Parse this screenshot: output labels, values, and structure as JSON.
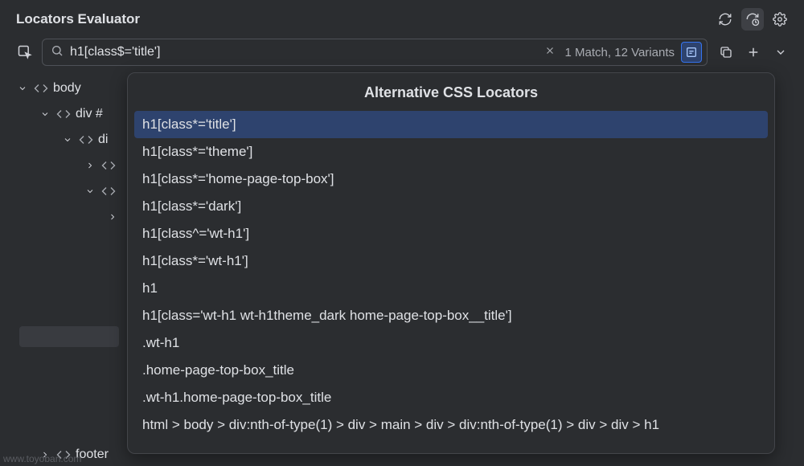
{
  "header": {
    "title": "Locators Evaluator"
  },
  "search": {
    "value": "h1[class$='title']",
    "match_text": "1 Match, 12 Variants"
  },
  "tree": {
    "n0": "body",
    "n1": "div #",
    "n2": "di",
    "n5": "footer"
  },
  "popup": {
    "title": "Alternative CSS Locators",
    "items": [
      "h1[class*='title']",
      "h1[class*='theme']",
      "h1[class*='home-page-top-box']",
      "h1[class*='dark']",
      "h1[class^='wt-h1']",
      "h1[class*='wt-h1']",
      "h1",
      "h1[class='wt-h1 wt-h1theme_dark home-page-top-box__title']",
      ".wt-h1",
      ".home-page-top-box_title",
      ".wt-h1.home-page-top-box_title",
      "html > body > div:nth-of-type(1) > div > main > div > div:nth-of-type(1) > div > div > h1"
    ]
  },
  "footer_ghost": "www.toyoban.com"
}
